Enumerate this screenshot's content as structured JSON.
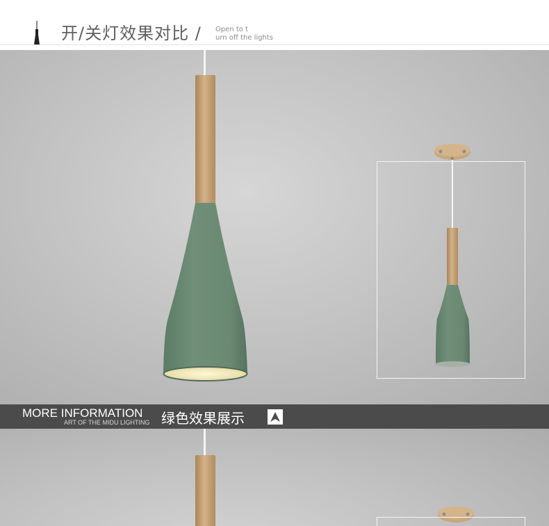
{
  "header": {
    "title": "开/关灯效果对比 /",
    "subtitle_line1": "Open to t",
    "subtitle_line2": "urn off the lights",
    "icon": "pendant-lamp-icon"
  },
  "info_bar": {
    "title": "MORE INFORMATION",
    "subtitle": "ART OF THE MIDU LIGHTING",
    "chinese_label": "绿色效果展示",
    "icon": "up-arrow-icon"
  },
  "colors": {
    "lamp_green": "#6b8a73",
    "wood": "#c9a77c",
    "background_gray": "#c4c4c4",
    "bar": "#4b4b4b"
  }
}
